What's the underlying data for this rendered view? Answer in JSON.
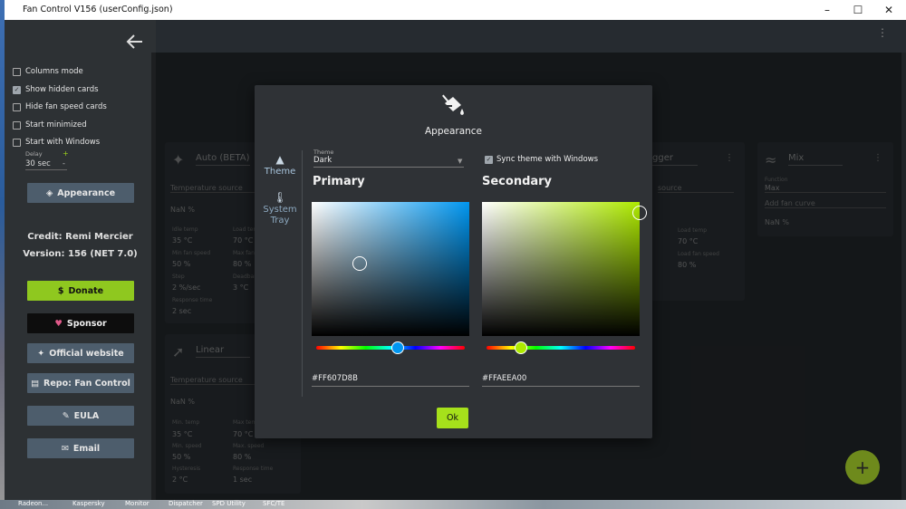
{
  "window": {
    "title": "Fan Control V156 (userConfig.json)"
  },
  "sidebar": {
    "checkboxes": [
      {
        "label": "Columns mode",
        "checked": false
      },
      {
        "label": "Show hidden cards",
        "checked": true
      },
      {
        "label": "Hide fan speed cards",
        "checked": false
      },
      {
        "label": "Start minimized",
        "checked": false
      },
      {
        "label": "Start with Windows",
        "checked": false
      }
    ],
    "delay": {
      "label": "Delay",
      "value": "30 sec",
      "plus": "+",
      "minus": "-"
    },
    "appearance_label": "Appearance",
    "credit": "Credit: Remi Mercier",
    "version": "Version: 156 (NET 7.0)",
    "donate_label": "Donate",
    "sponsor_label": "Sponsor",
    "website_label": "Official website",
    "repo_label": "Repo: Fan Control",
    "eula_label": "EULA",
    "email_label": "Email"
  },
  "cards": {
    "auto": {
      "title": "Auto (BETA)",
      "source": "Temperature source",
      "nan": "NaN %",
      "f1": "Idle temp",
      "v1": "35 °C",
      "f2": "Load temp",
      "v2": "70 °C",
      "f3": "Min fan speed",
      "v3": "50 %",
      "f4": "Max fan speed",
      "v4": "80 %",
      "f5": "Step",
      "v5": "2 %/sec",
      "f6": "Deadband",
      "v6": "3 °C",
      "f7": "Response time",
      "v7": "2 sec"
    },
    "linear": {
      "title": "Linear",
      "source": "Temperature source",
      "nan": "NaN %",
      "f1": "Min. temp",
      "v1": "35 °C",
      "f2": "Max temp",
      "v2": "70 °C",
      "f3": "Min. speed",
      "v3": "50 %",
      "f4": "Max. speed",
      "v4": "80 %",
      "f5": "Hysteresis",
      "v5": "2 °C",
      "f6": "Response time",
      "v6": "1 sec"
    },
    "trigger": {
      "title": "gger",
      "source": "source",
      "f1": "Load temp",
      "v1": "70 °C",
      "f2": "Load fan speed",
      "v2": "80 %"
    },
    "mix": {
      "title": "Mix",
      "f1": "Function",
      "v1": "Max",
      "f2": "Add fan curve",
      "nan": "NaN %"
    }
  },
  "dialog": {
    "title": "Appearance",
    "nav": {
      "theme": "Theme",
      "tray": "System Tray"
    },
    "theme_label": "Theme",
    "theme_value": "Dark",
    "sync_label": "Sync theme with Windows",
    "primary": {
      "label": "Primary",
      "hex": "#FF607D8B",
      "color": "#0096f0"
    },
    "secondary": {
      "label": "Secondary",
      "hex": "#FFAEEA00",
      "color": "#aeea00"
    },
    "ok_label": "Ok"
  },
  "taskbar": [
    "Radeon...",
    "Kaspersky",
    "Monitor",
    "Dispatcher",
    "SPD Utility",
    "SFC/TE"
  ]
}
